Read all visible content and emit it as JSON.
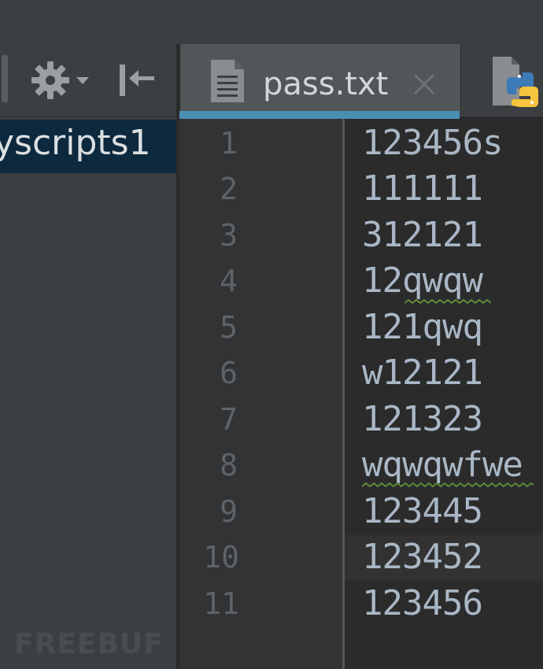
{
  "project": {
    "tree_item_label": "yscripts1"
  },
  "toolbar": {
    "icons": [
      "gear-icon",
      "chevron-down-icon",
      "collapse-all-icon"
    ]
  },
  "tabs": [
    {
      "label": "pass.txt",
      "icon": "text-file-icon",
      "active": true,
      "close_icon": "close-icon"
    },
    {
      "label": "",
      "icon": "python-file-icon",
      "active": false
    }
  ],
  "editor": {
    "lines": [
      {
        "number": "1",
        "text": "123456s"
      },
      {
        "number": "2",
        "text": "111111"
      },
      {
        "number": "3",
        "text": "312121"
      },
      {
        "number": "4",
        "text": "12qwqw",
        "spell_warning": true
      },
      {
        "number": "5",
        "text": "121qwq"
      },
      {
        "number": "6",
        "text": "w12121"
      },
      {
        "number": "7",
        "text": "121323"
      },
      {
        "number": "8",
        "text": "wqwqwfwe",
        "spell_warning": true
      },
      {
        "number": "9",
        "text": "123445"
      },
      {
        "number": "10",
        "text": "123452",
        "current_line": true
      },
      {
        "number": "11",
        "text": "123456"
      }
    ]
  },
  "watermark": "FREEBUF",
  "colors": {
    "background": "#2b2b2b",
    "panel": "#3c3f41",
    "selection": "#0d293e",
    "tab_accent": "#4a8fb0",
    "text": "#a9b7c6",
    "line_number": "#606366",
    "spell_squiggle": "#5f8a3a"
  }
}
